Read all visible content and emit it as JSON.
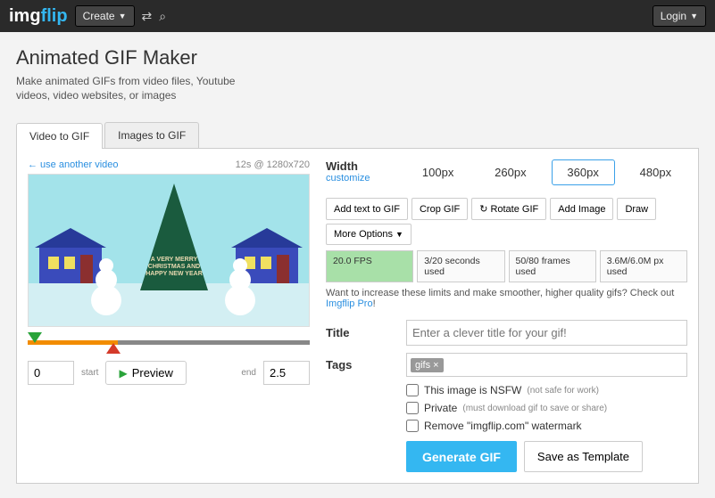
{
  "nav": {
    "brand1": "img",
    "brand2": "flip",
    "create": "Create",
    "login": "Login"
  },
  "header": {
    "title": "Animated GIF Maker",
    "subtitle": "Make animated GIFs from video files, Youtube videos, video websites, or images"
  },
  "tabs": {
    "video": "Video to GIF",
    "images": "Images to GIF"
  },
  "left": {
    "another": "← use another video",
    "meta": "12s @ 1280x720",
    "tree": "A VERY MERRY CHRISTMAS AND HAPPY NEW YEAR",
    "start_val": "0",
    "start_lbl": "start",
    "preview_btn": "Preview",
    "end_lbl": "end",
    "end_val": "2.5"
  },
  "right": {
    "width_lbl": "Width",
    "customize": "customize",
    "widths": [
      "100px",
      "260px",
      "360px",
      "480px"
    ],
    "tools": {
      "addtext": "Add text to GIF",
      "crop": "Crop GIF",
      "rotate": "Rotate GIF",
      "addimage": "Add Image",
      "draw": "Draw",
      "more": "More Options"
    },
    "stats": {
      "fps": "20.0 FPS",
      "seconds": "3/20 seconds used",
      "frames": "50/80 frames used",
      "px": "3.6M/6.0M px used"
    },
    "hint1": "Want to increase these limits and make smoother, higher quality gifs? Check out ",
    "hint_link": "Imgflip Pro",
    "hint2": "!",
    "title_lbl": "Title",
    "title_ph": "Enter a clever title for your gif!",
    "tags_lbl": "Tags",
    "tag": "gifs",
    "cb_nsfw": "This image is NSFW",
    "cb_nsfw_p": "(not safe for work)",
    "cb_private": "Private",
    "cb_private_p": "(must download gif to save or share)",
    "cb_wm": "Remove \"imgflip.com\" watermark",
    "generate": "Generate GIF",
    "save": "Save as Template"
  }
}
